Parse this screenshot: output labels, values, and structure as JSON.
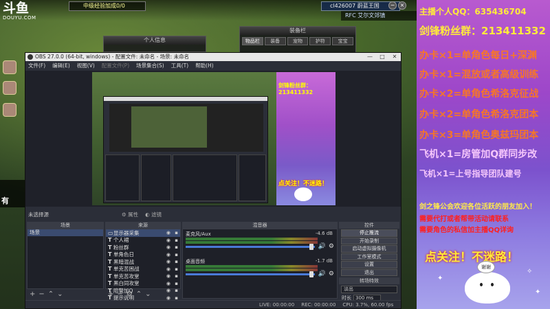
{
  "platform": {
    "logo": "斗鱼",
    "domain": "DOUYU.COM"
  },
  "game": {
    "player_bar": "中级经验加成0/0",
    "user_box": "cl426007 蔚蓝王国",
    "chat_line": "RFC 艾尔文郊镇",
    "personal_window_title": "个人信息",
    "equip_window_title": "装备栏",
    "equip_tabs": [
      "物品栏",
      "装备",
      "宠物",
      "护符",
      "宝宝"
    ],
    "left_chip": "有"
  },
  "obs": {
    "title": "OBS 27.0.0 (64-bit, windows) - 配置文件: 未命名 - 场景: 未命名",
    "window_controls": [
      "—",
      "□",
      "✕"
    ],
    "menu": [
      "文件(F)",
      "编辑(E)",
      "视图(V)",
      "配置文件(P)",
      "场景集合(S)",
      "工具(T)",
      "帮助(H)"
    ],
    "status_selection": "未选择源",
    "props_label": "属性",
    "filters_label": "滤镜",
    "docks": {
      "scenes": "场景",
      "sources": "来源",
      "mixer": "混音器",
      "controls": "控件"
    },
    "scenes": [
      "场景"
    ],
    "sources": [
      {
        "name": "显示器采集",
        "type": "monitor"
      },
      {
        "name": "个人裙",
        "type": "text"
      },
      {
        "name": "粉丝群",
        "type": "text"
      },
      {
        "name": "单角色日",
        "type": "text"
      },
      {
        "name": "黑暗混战",
        "type": "text"
      },
      {
        "name": "单克苦困战",
        "type": "text"
      },
      {
        "name": "单克苦攻堂",
        "type": "text"
      },
      {
        "name": "黑白同攻堂",
        "type": "text"
      },
      {
        "name": "陪警加Q",
        "type": "text"
      },
      {
        "name": "提示说明",
        "type": "text"
      }
    ],
    "mixer": [
      {
        "name": "桌面音频",
        "db": "-1.7 dB"
      },
      {
        "name": "麦克风/Aux",
        "db": "-4.6 dB"
      }
    ],
    "controls": [
      "停止推流",
      "开始录制",
      "启动虚拟摄像机",
      "工作室模式",
      "设置",
      "退出"
    ],
    "transitions_title": "转场特效",
    "transition_value": "淡出",
    "duration_label": "时长",
    "duration_value": "300 ms",
    "statusbar": {
      "live": "LIVE: 00:00:00",
      "rec": "REC: 00:00:00",
      "cpu": "CPU: 3.7%, 60.00 fps"
    }
  },
  "nested_preview": {
    "fans_text": "剑锋粉丝群：213411332",
    "follow_text": "点关注！不迷路！"
  },
  "stream_panel": {
    "qq": "主播个人QQ：635436704",
    "fans_group": "剑锋粉丝群：213411332",
    "offers": [
      "办卡×1=单角色每日+深渊",
      "办卡×1=混放或者高级训练",
      "办卡×2=单角色希洛克征战",
      "办卡×2=单角色希洛克团本",
      "办卡×3=单角色奥兹玛团本",
      "飞机×1=房管加Q群同步改",
      "飞机×1=上号指导团队建号"
    ],
    "guild": "剑之锋公会欢迎各位活跃的朋友加入！",
    "red_lines": [
      "需要代打或者帮带活动请联系",
      "需要角色的私信加主播QQ详询"
    ],
    "follow": "点关注！不迷路！",
    "mascot_bubble": "谢谢"
  }
}
